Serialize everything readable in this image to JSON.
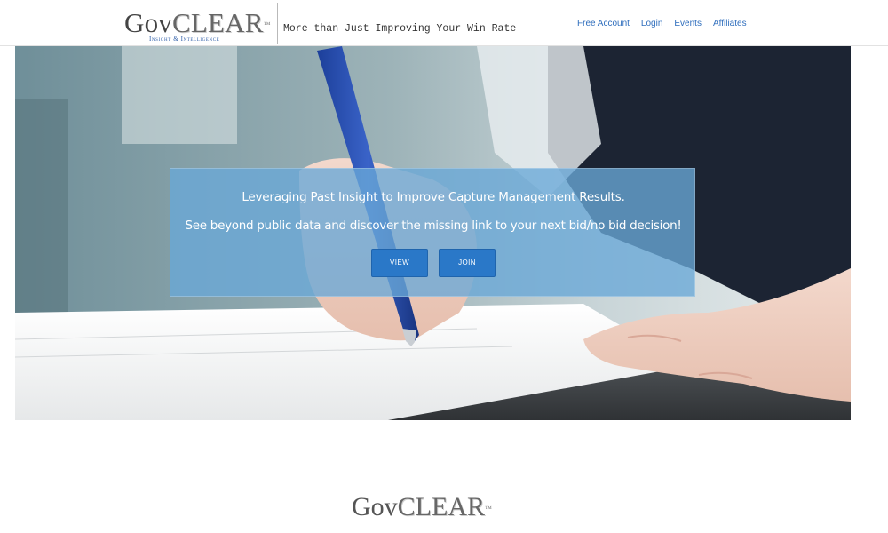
{
  "header": {
    "logo": {
      "gov": "Gov",
      "clear": "CLEAR",
      "tm": "™",
      "subtitle": "Insight & Intelligence"
    },
    "tagline": "More than Just Improving Your Win Rate",
    "nav": [
      {
        "label": "Free Account"
      },
      {
        "label": "Login"
      },
      {
        "label": "Events"
      },
      {
        "label": "Affiliates"
      }
    ]
  },
  "hero": {
    "line1": "Leveraging Past Insight to Improve Capture Management Results.",
    "line2": "See beyond public data and discover the missing link to your next bid/no bid decision!",
    "view_label": "VIEW",
    "join_label": "JOIN"
  },
  "footer": {
    "logo": {
      "gov": "Gov",
      "clear": "CLEAR",
      "tm": "™"
    }
  },
  "colors": {
    "link": "#2f6ebd",
    "overlay": "#69a8d7",
    "button": "#2a78c8",
    "logo_sub": "#2a5aa6"
  }
}
